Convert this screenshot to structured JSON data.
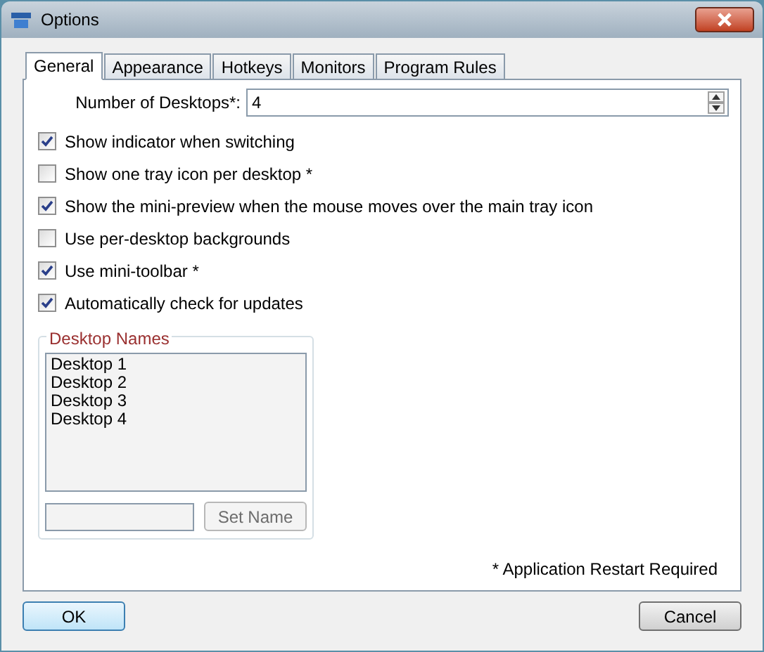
{
  "window": {
    "title": "Options"
  },
  "tabs": [
    {
      "label": "General",
      "selected": true
    },
    {
      "label": "Appearance",
      "selected": false
    },
    {
      "label": "Hotkeys",
      "selected": false
    },
    {
      "label": "Monitors",
      "selected": false
    },
    {
      "label": "Program Rules",
      "selected": false
    }
  ],
  "desktops_count": {
    "label": "Number of Desktops*:",
    "value": "4"
  },
  "options": [
    {
      "label": "Show indicator when switching",
      "checked": true
    },
    {
      "label": "Show one tray icon per desktop *",
      "checked": false
    },
    {
      "label": "Show the mini-preview when the mouse moves over the main tray icon",
      "checked": true
    },
    {
      "label": "Use per-desktop backgrounds",
      "checked": false
    },
    {
      "label": "Use mini-toolbar *",
      "checked": true
    },
    {
      "label": "Automatically check for updates",
      "checked": true
    }
  ],
  "desktop_names": {
    "title": "Desktop Names",
    "items": [
      "Desktop 1",
      "Desktop 2",
      "Desktop 3",
      "Desktop 4"
    ],
    "set_button": {
      "label": "Set Name",
      "disabled": true
    }
  },
  "note": "* Application Restart Required",
  "buttons": [
    {
      "label": "OK",
      "kind": "default"
    },
    {
      "label": "Cancel",
      "kind": "normal"
    }
  ]
}
